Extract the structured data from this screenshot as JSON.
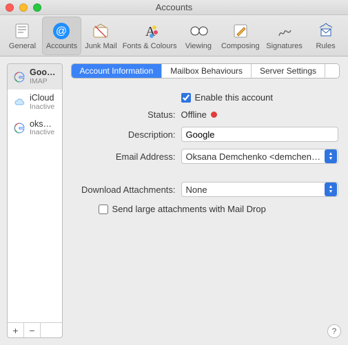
{
  "window": {
    "title": "Accounts"
  },
  "toolbar": {
    "items": [
      {
        "name": "general",
        "label": "General"
      },
      {
        "name": "accounts",
        "label": "Accounts",
        "selected": true
      },
      {
        "name": "junkmail",
        "label": "Junk Mail"
      },
      {
        "name": "fonts",
        "label": "Fonts & Colours"
      },
      {
        "name": "viewing",
        "label": "Viewing"
      },
      {
        "name": "composing",
        "label": "Composing"
      },
      {
        "name": "signatures",
        "label": "Signatures"
      },
      {
        "name": "rules",
        "label": "Rules"
      }
    ]
  },
  "sidebar": {
    "accounts": [
      {
        "name": "Google",
        "sub": "IMAP",
        "icon": "google",
        "selected": true
      },
      {
        "name": "iCloud",
        "sub": "Inactive",
        "icon": "icloud"
      },
      {
        "name": "oksana.a.d…",
        "sub": "Inactive",
        "icon": "google"
      }
    ],
    "add": "+",
    "remove": "−"
  },
  "tabs": {
    "items": [
      {
        "label": "Account Information",
        "active": true
      },
      {
        "label": "Mailbox Behaviours"
      },
      {
        "label": "Server Settings"
      }
    ]
  },
  "form": {
    "enable_label": "Enable this account",
    "enable_checked": true,
    "status_label": "Status:",
    "status_value": "Offline",
    "description_label": "Description:",
    "description_value": "Google",
    "email_label": "Email Address:",
    "email_value": "Oksana Demchenko <demchen…",
    "download_label": "Download Attachments:",
    "download_value": "None",
    "maildrop_label": "Send large attachments with Mail Drop",
    "maildrop_checked": false
  },
  "help": "?"
}
